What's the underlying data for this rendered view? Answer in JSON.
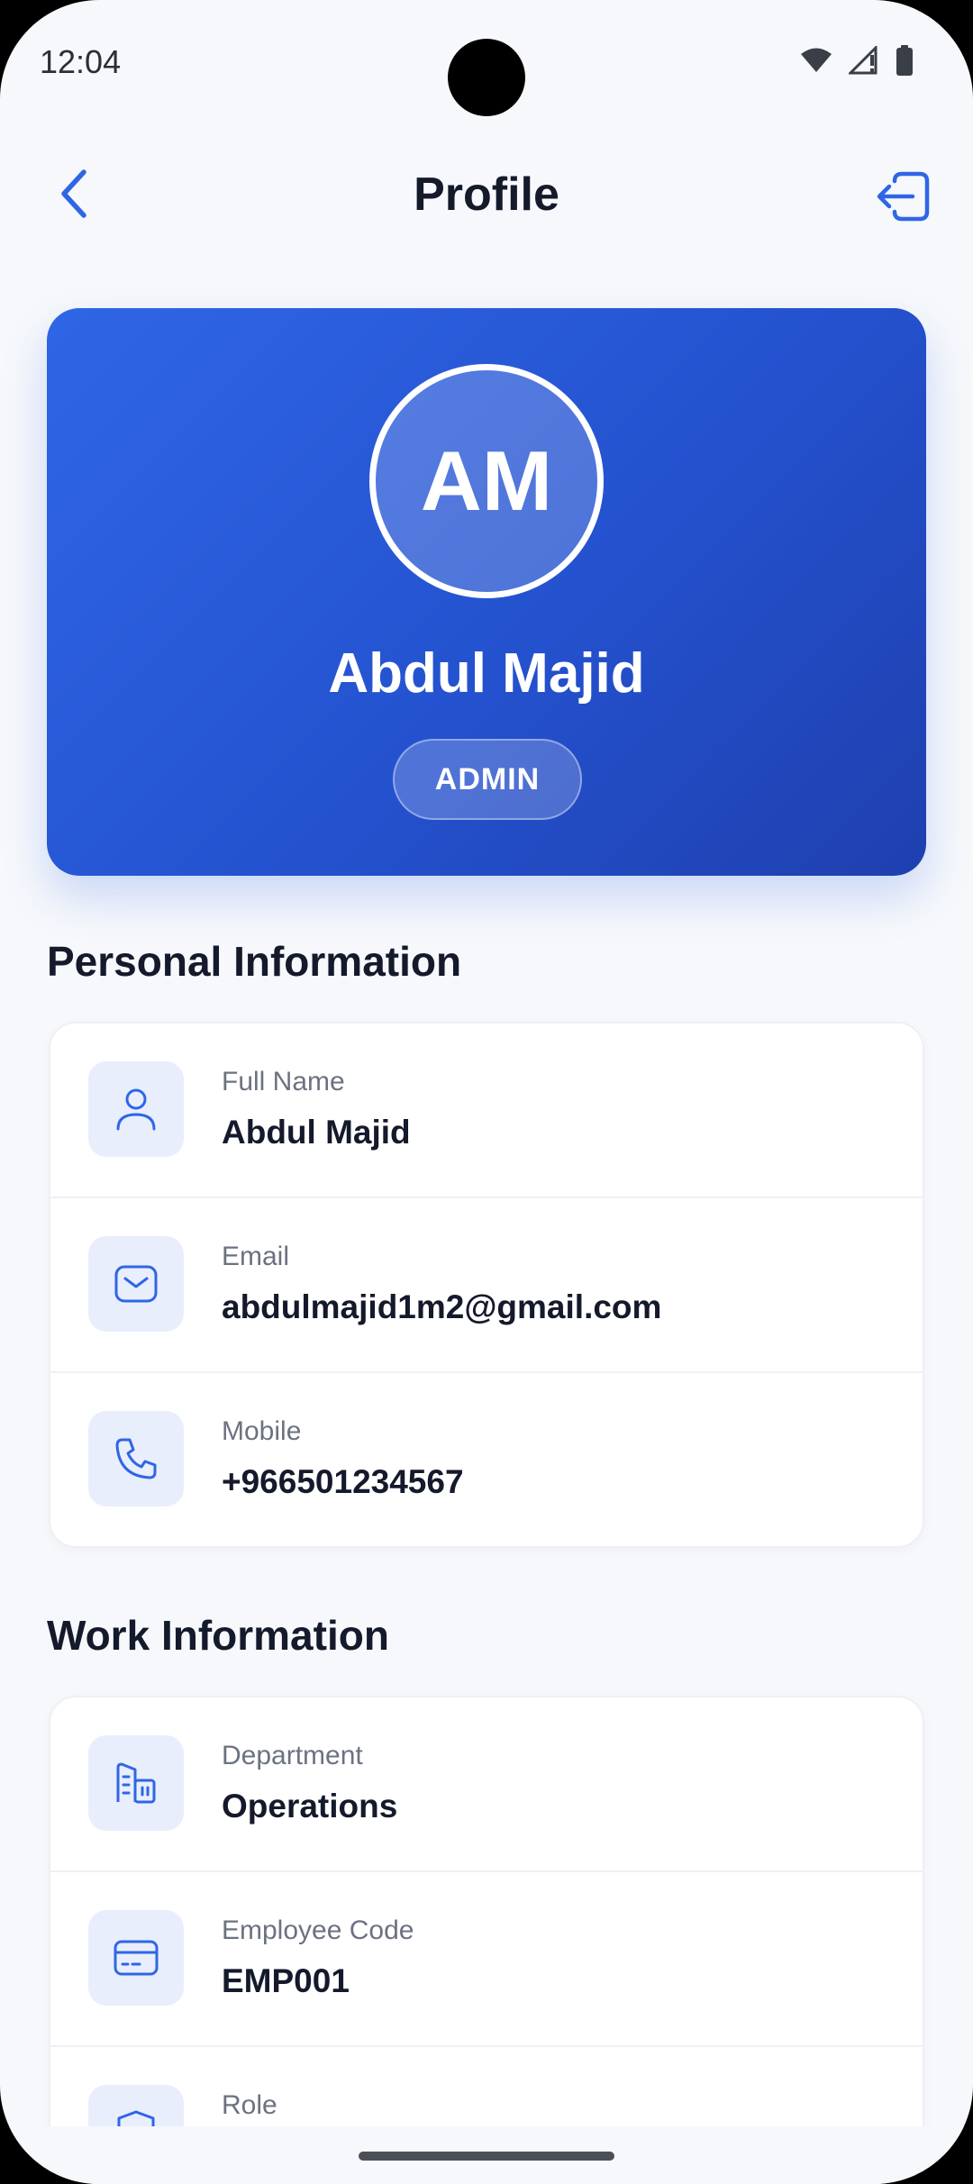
{
  "status_bar": {
    "time": "12:04"
  },
  "header": {
    "title": "Profile"
  },
  "profile": {
    "initials": "AM",
    "name": "Abdul Majid",
    "role": "ADMIN"
  },
  "personal_info": {
    "title": "Personal Information",
    "rows": [
      {
        "label": "Full Name",
        "value": "Abdul Majid",
        "icon": "user-icon"
      },
      {
        "label": "Email",
        "value": "abdulmajid1m2@gmail.com",
        "icon": "mail-icon"
      },
      {
        "label": "Mobile",
        "value": "+966501234567",
        "icon": "phone-icon"
      }
    ]
  },
  "work_info": {
    "title": "Work Information",
    "rows": [
      {
        "label": "Department",
        "value": "Operations",
        "icon": "building-icon"
      },
      {
        "label": "Employee Code",
        "value": "EMP001",
        "icon": "id-card-icon"
      },
      {
        "label": "Role",
        "value": "",
        "icon": "shield-icon"
      }
    ]
  },
  "colors": {
    "accent": "#2f66e6",
    "accent_dark": "#1f3fae",
    "icon_tile": "#e9eefc",
    "text": "#141a2b",
    "muted": "#6b7280"
  }
}
